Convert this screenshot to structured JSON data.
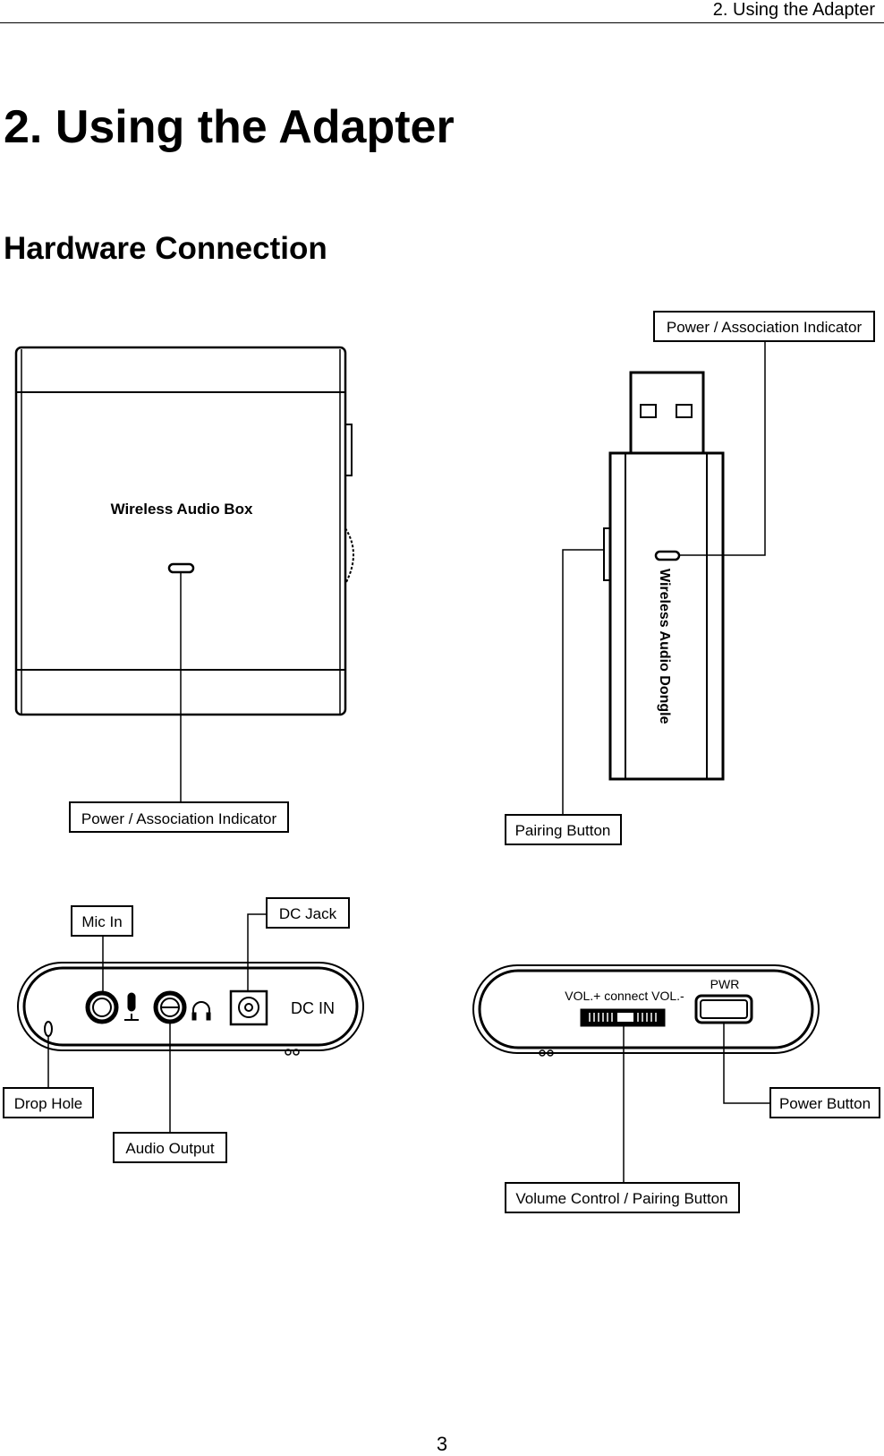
{
  "running_header": "2. Using the Adapter",
  "title": "2. Using the Adapter",
  "section_heading": "Hardware Connection",
  "page_number": "3",
  "figure": {
    "box_front": {
      "device_label": "Wireless Audio Box",
      "callouts": {
        "indicator": "Power / Association Indicator"
      }
    },
    "dongle": {
      "device_label": "Wireless Audio Dongle",
      "callouts": {
        "indicator": "Power / Association Indicator",
        "pairing": "Pairing Button"
      }
    },
    "box_side_ports": {
      "port_label": "DC IN",
      "callouts": {
        "mic_in": "Mic In",
        "dc_jack": "DC Jack",
        "drop_hole": "Drop Hole",
        "audio_output": "Audio Output"
      }
    },
    "box_side_controls": {
      "volume_label": "VOL.+ connect VOL.-",
      "power_label": "PWR",
      "callouts": {
        "power_button": "Power Button",
        "volume": "Volume Control / Pairing Button"
      }
    }
  }
}
